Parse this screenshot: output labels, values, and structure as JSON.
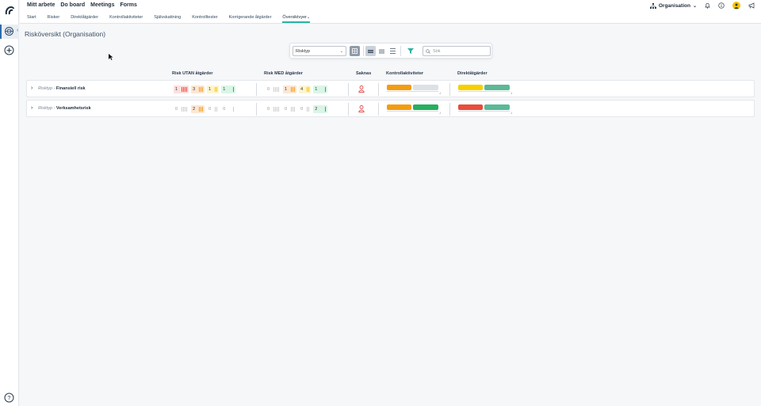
{
  "topnav": [
    "Mitt arbete",
    "Do board",
    "Meetings",
    "Forms"
  ],
  "topright": {
    "org_label": "Organisation"
  },
  "tabs": [
    "Start",
    "Risker",
    "Direktåtgärder",
    "Kontrollaktiviteter",
    "Självskattning",
    "Kontrolltester",
    "Korrigerande åtgärder",
    "Översiktvyer"
  ],
  "active_tab": "Översiktvyer",
  "page_title": "Risköversikt (Organisation)",
  "toolbar": {
    "select_value": "Risktyp",
    "search_placeholder": "Sök"
  },
  "columns": {
    "risk_utan": "Risk UTAN åtgärder",
    "risk_med": "Risk MED åtgärder",
    "saknas": "Saknas",
    "kontroll": "Kontrollaktiviteter",
    "direkt": "Direktåtgärder"
  },
  "colors": {
    "red_bg": "#fde0de",
    "orange_bg": "#fde6d2",
    "yellow_bg": "#fff4cf",
    "green_bg": "#daf5e6",
    "orange_bar": "#f39c12",
    "grey_bar": "#dde1e6",
    "green_bar": "#27ae60",
    "yellow_bar": "#f5d000",
    "teal_bar": "#5cb897",
    "red_bar": "#e74c3c"
  },
  "rows": [
    {
      "prefix": "Risktyp",
      "sep": " - ",
      "name": "Finansiell risk",
      "utan": [
        "1",
        "3",
        "1",
        "1"
      ],
      "med": [
        "0",
        "1",
        "4",
        "1"
      ],
      "saknas_icon": "person-icon"
    },
    {
      "prefix": "Risktyp",
      "sep": " - ",
      "name": "Verksamhetsrisk",
      "utan": [
        "0",
        "2",
        "0",
        "0"
      ],
      "med": [
        "0",
        "0",
        "0",
        "2"
      ],
      "saknas_icon": "person-icon"
    }
  ]
}
